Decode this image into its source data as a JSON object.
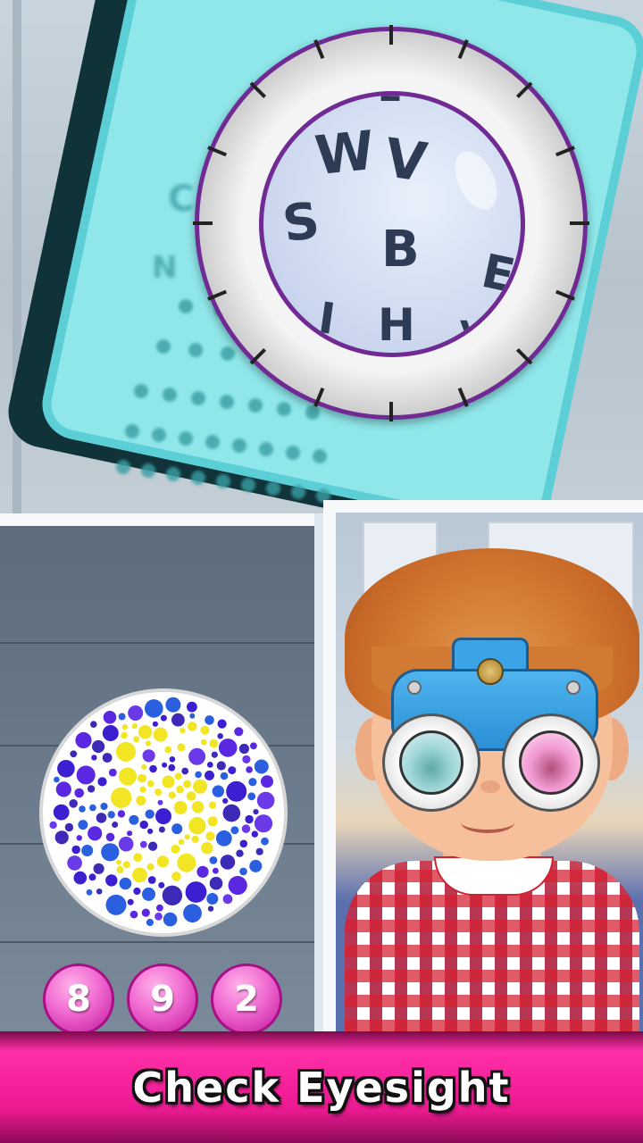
{
  "eye_chart": {
    "lens_letters": [
      "E",
      "W",
      "V",
      "S",
      "B",
      "E",
      "I",
      "H",
      "V"
    ],
    "background_letters": [
      "C",
      "N"
    ]
  },
  "color_test": {
    "plate_number": "5",
    "answer_options": [
      "8",
      "9",
      "2"
    ],
    "colors": {
      "dots": "#3b1fd1",
      "number": "#f2e524"
    }
  },
  "banner": {
    "title": "Check Eyesight"
  },
  "colors": {
    "chart_board": "#8fe7ea",
    "lens_rim": "#6f2a93",
    "answer_button": "#f06ad0",
    "banner": "#ec1a91",
    "phoropter": "#2a8fd6"
  }
}
